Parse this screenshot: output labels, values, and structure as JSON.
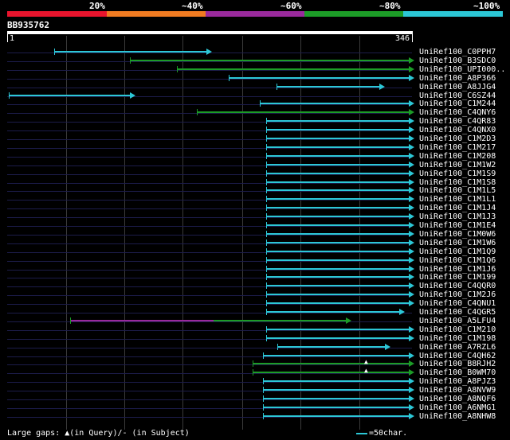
{
  "header": {
    "pct_labels": [
      "20%",
      "~40%",
      "~60%",
      "~80%",
      "~100%"
    ],
    "colors": [
      "#e8142d",
      "#f07b21",
      "#9a2a9c",
      "#1c9c27",
      "#2cc7d6"
    ]
  },
  "query": {
    "name": "BB935762",
    "start": "1",
    "end": "346"
  },
  "hits": [
    {
      "name": "UniRef100_C0PPH7",
      "color": "cyan",
      "start": 68,
      "end": 262
    },
    {
      "name": "UniRef100_B3SDC0",
      "color": "green",
      "start": 163,
      "end": 516
    },
    {
      "name": "UniRef100_UPI000..",
      "color": "green",
      "start": 222,
      "end": 516,
      "gap": [
        222,
        243
      ],
      "gapcolor": "green"
    },
    {
      "name": "UniRef100_A8P366",
      "color": "cyan",
      "start": 287,
      "end": 516
    },
    {
      "name": "UniRef100_A8JJG4",
      "color": "cyan",
      "start": 347,
      "end": 479
    },
    {
      "name": "UniRef100_C6SZ44",
      "color": "cyan",
      "start": 11,
      "end": 166
    },
    {
      "name": "UniRef100_C1M244",
      "color": "cyan",
      "start": 326,
      "end": 516
    },
    {
      "name": "UniRef100_C4QNY6",
      "color": "green",
      "start": 247,
      "end": 516
    },
    {
      "name": "UniRef100_C4QR83",
      "color": "cyan",
      "start": 334,
      "end": 516
    },
    {
      "name": "UniRef100_C4QNX0",
      "color": "cyan",
      "start": 334,
      "end": 516
    },
    {
      "name": "UniRef100_C1M2D3",
      "color": "cyan",
      "start": 334,
      "end": 516
    },
    {
      "name": "UniRef100_C1M217",
      "color": "cyan",
      "start": 334,
      "end": 516
    },
    {
      "name": "UniRef100_C1M208",
      "color": "cyan",
      "start": 334,
      "end": 516
    },
    {
      "name": "UniRef100_C1M1W2",
      "color": "cyan",
      "start": 334,
      "end": 516
    },
    {
      "name": "UniRef100_C1M1S9",
      "color": "cyan",
      "start": 334,
      "end": 516
    },
    {
      "name": "UniRef100_C1M1S8",
      "color": "cyan",
      "start": 334,
      "end": 516
    },
    {
      "name": "UniRef100_C1M1L5",
      "color": "cyan",
      "start": 334,
      "end": 516
    },
    {
      "name": "UniRef100_C1M1L1",
      "color": "cyan",
      "start": 334,
      "end": 516
    },
    {
      "name": "UniRef100_C1M1J4",
      "color": "cyan",
      "start": 334,
      "end": 516
    },
    {
      "name": "UniRef100_C1M1J3",
      "color": "cyan",
      "start": 334,
      "end": 516
    },
    {
      "name": "UniRef100_C1M1E4",
      "color": "cyan",
      "start": 334,
      "end": 516
    },
    {
      "name": "UniRef100_C1M0W6",
      "color": "cyan",
      "start": 334,
      "end": 516
    },
    {
      "name": "UniRef100_C1M1W6",
      "color": "cyan",
      "start": 334,
      "end": 516
    },
    {
      "name": "UniRef100_C1M1Q9",
      "color": "cyan",
      "start": 334,
      "end": 516
    },
    {
      "name": "UniRef100_C1M1Q6",
      "color": "cyan",
      "start": 334,
      "end": 516
    },
    {
      "name": "UniRef100_C1M1J6",
      "color": "cyan",
      "start": 334,
      "end": 516
    },
    {
      "name": "UniRef100_C1M199",
      "color": "cyan",
      "start": 334,
      "end": 516
    },
    {
      "name": "UniRef100_C4QQR0",
      "color": "cyan",
      "start": 334,
      "end": 516
    },
    {
      "name": "UniRef100_C1M2J6",
      "color": "cyan",
      "start": 334,
      "end": 516
    },
    {
      "name": "UniRef100_C4QNU1",
      "color": "cyan",
      "start": 334,
      "end": 516
    },
    {
      "name": "UniRef100_C4QGR5",
      "color": "cyan",
      "start": 334,
      "end": 504
    },
    {
      "name": "UniRef100_A5LFU4",
      "color": "green",
      "start": 88,
      "end": 437,
      "gap": [
        88,
        268
      ],
      "gapcolor": "purple"
    },
    {
      "name": "UniRef100_C1M210",
      "color": "cyan",
      "start": 334,
      "end": 516
    },
    {
      "name": "UniRef100_C1M198",
      "color": "cyan",
      "start": 334,
      "end": 516
    },
    {
      "name": "UniRef100_A7RZL6",
      "color": "cyan",
      "start": 348,
      "end": 486
    },
    {
      "name": "UniRef100_C4QH62",
      "color": "cyan",
      "start": 330,
      "end": 516
    },
    {
      "name": "UniRef100_B8RJH2",
      "color": "green",
      "start": 317,
      "end": 516,
      "mark": 460
    },
    {
      "name": "UniRef100_B0WM70",
      "color": "green",
      "start": 317,
      "end": 516,
      "mark": 460
    },
    {
      "name": "UniRef100_A8PJZ3",
      "color": "cyan",
      "start": 330,
      "end": 516
    },
    {
      "name": "UniRef100_A8NVW9",
      "color": "cyan",
      "start": 330,
      "end": 516
    },
    {
      "name": "UniRef100_A8NQF6",
      "color": "cyan",
      "start": 330,
      "end": 516
    },
    {
      "name": "UniRef100_A6NMG1",
      "color": "cyan",
      "start": 330,
      "end": 516
    },
    {
      "name": "UniRef100_A8NHW8",
      "color": "cyan",
      "start": 330,
      "end": 516
    }
  ],
  "footer": {
    "text": "Large gaps: ▲(in Query)/- (in Subject)",
    "legend": "=50char."
  }
}
